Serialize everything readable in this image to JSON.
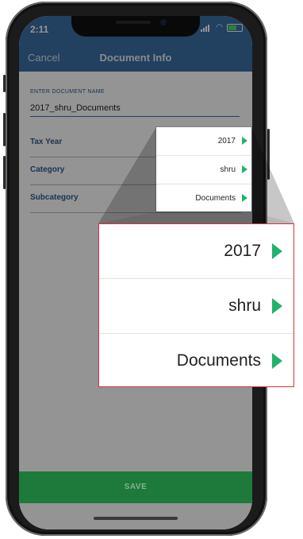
{
  "status_bar": {
    "time": "2:11"
  },
  "header": {
    "cancel_label": "Cancel",
    "title": "Document Info"
  },
  "form": {
    "name_label": "ENTER DOCUMENT NAME",
    "name_value": "2017_shru_Documents",
    "rows": [
      {
        "label": "Tax Year",
        "value": "2017"
      },
      {
        "label": "Category",
        "value": "shru"
      },
      {
        "label": "Subcategory",
        "value": "Documents"
      }
    ]
  },
  "save_label": "SAVE",
  "colors": {
    "header": "#3b6ea5",
    "save": "#1e7a3a",
    "arrow": "#23b26b",
    "zoom_border": "#d9323a"
  },
  "icons": [
    "signal-icon",
    "wifi-icon",
    "battery-icon",
    "chevron-right-icon"
  ]
}
